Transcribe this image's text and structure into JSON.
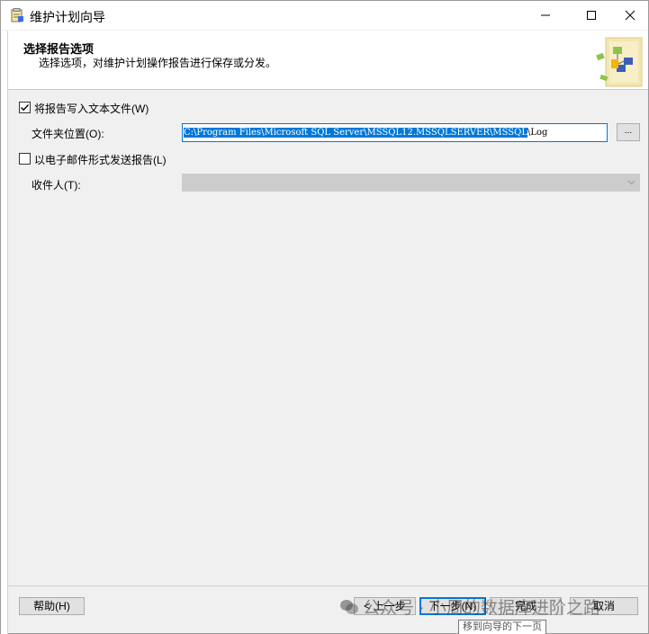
{
  "window": {
    "title": "维护计划向导"
  },
  "caption_buttons": {
    "minimize": "—",
    "maximize": "☐",
    "close": "✕"
  },
  "header": {
    "title": "选择报告选项",
    "subtitle": "选择选项，对维护计划操作报告进行保存或分发。"
  },
  "write_to_file": {
    "label": "将报告写入文本文件(W)",
    "checked": true
  },
  "folder": {
    "label": "文件夹位置(O):",
    "value_selected": "C:\\Program Files\\Microsoft SQL Server\\MSSQL12.MSSQLSERVER\\MSSQL",
    "value_rest": "\\Log",
    "browse_label": "..."
  },
  "email": {
    "label": "以电子邮件形式发送报告(L)",
    "checked": false
  },
  "recipient": {
    "label": "收件人(T):",
    "value": ""
  },
  "buttons": {
    "help": "帮助(H)",
    "back": "< 上一步",
    "next": "下一步(N)",
    "finish": "完成",
    "cancel": "取消"
  },
  "tooltip": "移到向导的下一页",
  "watermark": "公众号 · 小周的数据库进阶之路",
  "colors": {
    "accent": "#0078d7",
    "window_bg": "#f0f0f0",
    "header_bg": "#ffffff"
  },
  "icons": {
    "app": "wizard-icon",
    "header": "maintenance-plan-graphic",
    "combo": "chevron-down-icon"
  }
}
